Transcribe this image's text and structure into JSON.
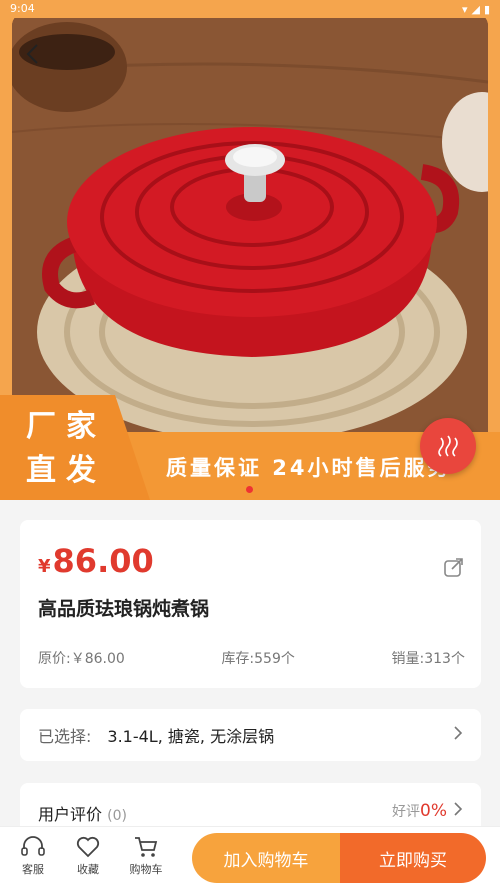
{
  "status_bar": {
    "time": "9:04"
  },
  "banner": {
    "left_line1": "厂家",
    "left_line2": "直发",
    "slogan": "质量保证 24小时售后服务"
  },
  "product": {
    "currency": "¥",
    "price": "86.00",
    "title": "高品质珐琅锅炖煮锅",
    "original_price": "原价:￥86.00",
    "stock": "库存:559个",
    "sales": "销量:313个"
  },
  "selection": {
    "label": "已选择:",
    "value": "3.1-4L, 搪瓷, 无涂层锅"
  },
  "reviews": {
    "title": "用户评价",
    "count": "(0)",
    "good_label": "好评",
    "good_pct": "0%"
  },
  "bottom_bar": {
    "service_label": "客服",
    "favorite_label": "收藏",
    "cart_label": "购物车",
    "add_to_cart": "加入购物车",
    "buy_now": "立即购买"
  },
  "colors": {
    "accent_orange": "#f39835",
    "price_red": "#e03a2e",
    "buy_orange": "#f26a2a"
  }
}
